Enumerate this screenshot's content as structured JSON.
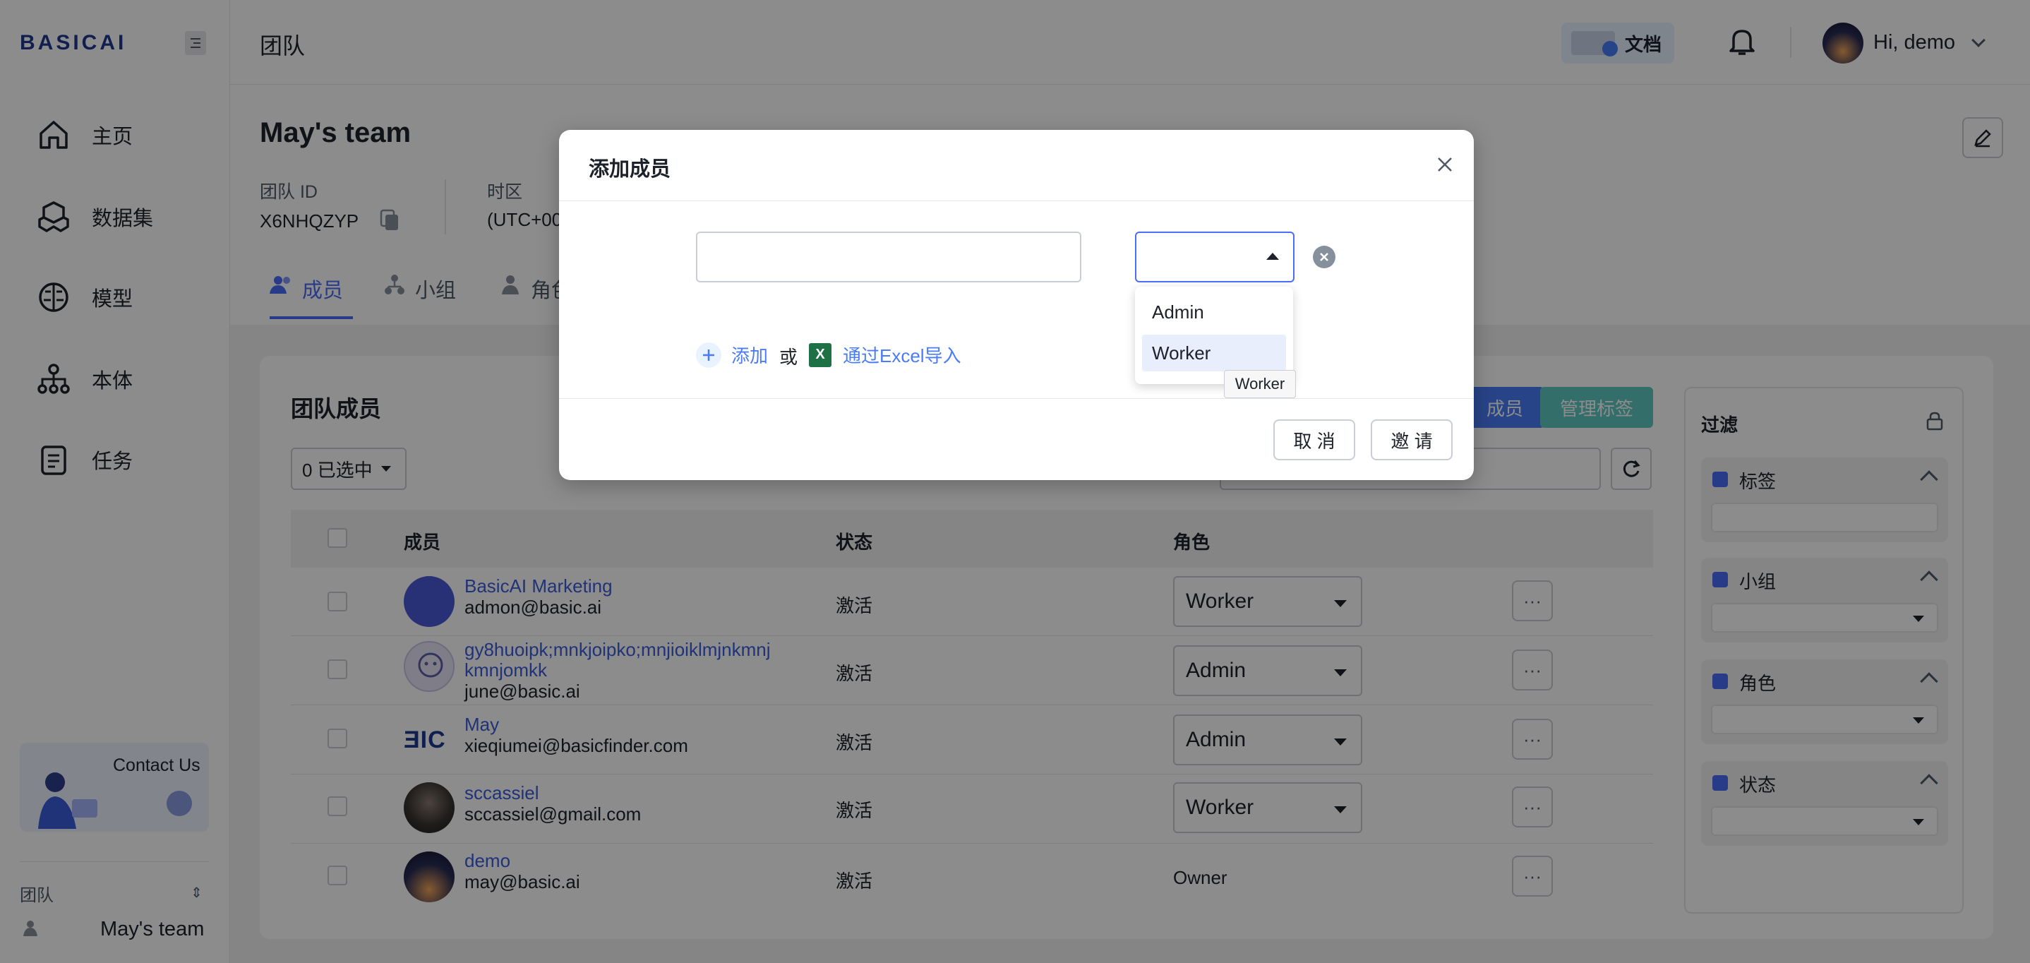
{
  "app": {
    "logo_text": "BASICAI",
    "page_title": "团队",
    "docs_label": "文档",
    "greeting": "Hi, demo"
  },
  "sidebar": {
    "items": [
      {
        "label": "主页",
        "icon": "home-icon"
      },
      {
        "label": "数据集",
        "icon": "dataset-icon"
      },
      {
        "label": "模型",
        "icon": "brain-icon"
      },
      {
        "label": "本体",
        "icon": "ontology-icon"
      },
      {
        "label": "任务",
        "icon": "task-icon"
      }
    ],
    "contact_label": "Contact Us",
    "team_section_label": "团队",
    "current_team": "May's team"
  },
  "team": {
    "name": "May's team",
    "id_label": "团队 ID",
    "id_value": "X6NHQZYP",
    "timezone_label": "时区",
    "timezone_value": "(UTC+00"
  },
  "tabs": [
    {
      "label": "成员",
      "icon": "users-icon",
      "active": true
    },
    {
      "label": "小组",
      "icon": "group-icon",
      "active": false
    },
    {
      "label": "角色",
      "icon": "role-icon",
      "active": false
    }
  ],
  "members_card": {
    "title": "团队成员",
    "selected_label": "0 已选中",
    "add_member_label": "成员",
    "manage_tags_label": "管理标签",
    "columns": {
      "member": "成员",
      "status": "状态",
      "role": "角色"
    },
    "rows": [
      {
        "name": "BasicAI Marketing",
        "email": "admon@basic.ai",
        "status": "激活",
        "role": "Worker",
        "editable": true
      },
      {
        "name": "gy8huoipk;mnkjoipko;mnjioiklmjnkmnj",
        "name_line2": "kmnjomkk",
        "email": "june@basic.ai",
        "status": "激活",
        "role": "Admin",
        "editable": true
      },
      {
        "name": "May",
        "email": "xieqiumei@basicfinder.com",
        "status": "激活",
        "role": "Admin",
        "editable": true,
        "avatar_text": "ƎIC"
      },
      {
        "name": "sccassiel",
        "email": "sccassiel@gmail.com",
        "status": "激活",
        "role": "Worker",
        "editable": true
      },
      {
        "name": "demo",
        "email": "may@basic.ai",
        "status": "激活",
        "role": "Owner",
        "editable": false
      }
    ],
    "more_label": "···"
  },
  "filter": {
    "title": "过滤",
    "groups": [
      {
        "label": "标签",
        "icon_color": "#4a6cf7"
      },
      {
        "label": "小组",
        "icon_color": "#4a6cf7"
      },
      {
        "label": "角色",
        "icon_color": "#4a6cf7"
      },
      {
        "label": "状态",
        "icon_color": "#4a6cf7"
      }
    ]
  },
  "modal": {
    "title": "添加成员",
    "email_value": "",
    "role_value": "",
    "role_options": [
      "Admin",
      "Worker"
    ],
    "highlighted_option": "Worker",
    "tooltip": "Worker",
    "add_label": "添加",
    "or_label": "或",
    "import_label": "通过Excel导入",
    "cancel_label": "取 消",
    "invite_label": "邀 请"
  },
  "colors": {
    "accent": "#3b5bdb",
    "active_tab": "#4a6cf7",
    "teal_button": "#5ec8c4",
    "blue_button": "#4a7cf7",
    "excel_green": "#1e7145"
  }
}
